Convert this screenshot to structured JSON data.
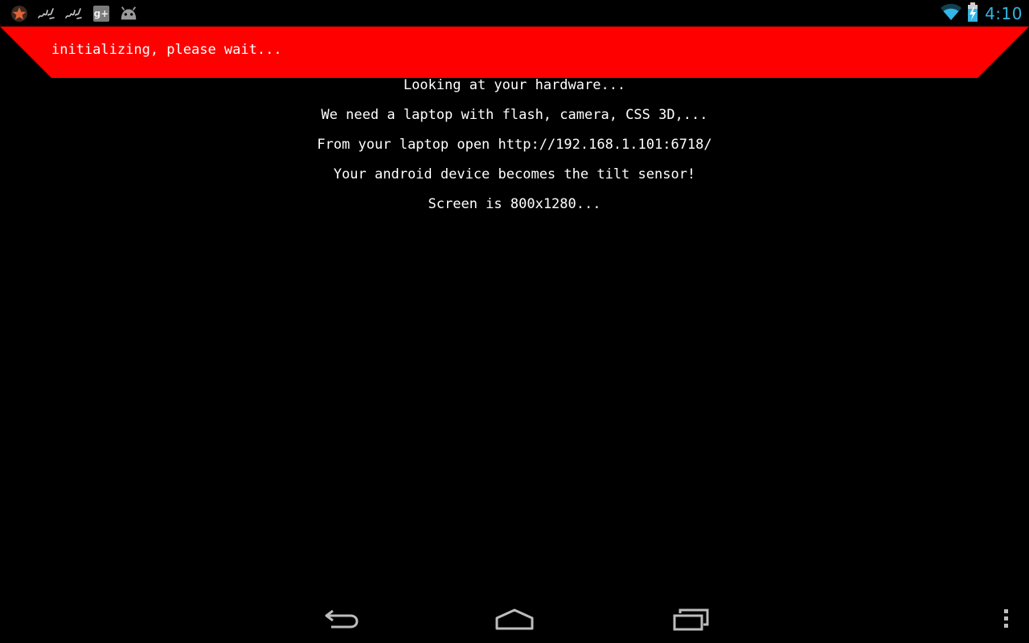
{
  "status_bar": {
    "notifications": [
      "star-icon",
      "scribble-icon",
      "scribble-icon",
      "google-plus-icon",
      "android-icon"
    ],
    "gplus_label": "g+",
    "time": "4:10",
    "accent_color": "#33b5e5"
  },
  "banner": {
    "text": "initializing, please wait...",
    "color": "#ff0000"
  },
  "messages": {
    "line1": "Looking at your hardware...",
    "line2": "We need a laptop with flash, camera, CSS 3D,...",
    "line3": "From your laptop open http://192.168.1.101:6718/",
    "line4": "Your android device becomes the tilt sensor!",
    "line5": "Screen is 800x1280..."
  },
  "nav_bar": {
    "buttons": [
      "back-icon",
      "home-icon",
      "recent-apps-icon"
    ],
    "overflow": "overflow-menu-icon"
  }
}
